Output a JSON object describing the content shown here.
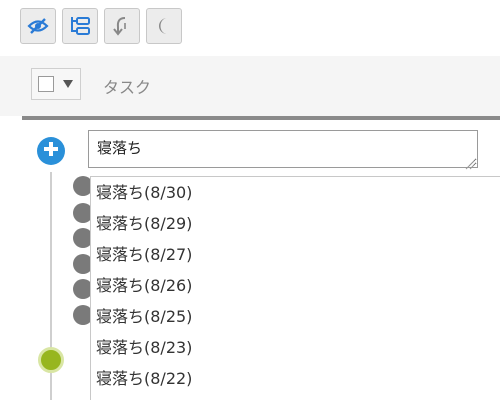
{
  "toolbar": {
    "buttons": [
      {
        "icon": "eye-slash-icon",
        "color": "#2a7bd6"
      },
      {
        "icon": "subtask-list-icon",
        "color": "#2a7bd6"
      },
      {
        "icon": "arrow-down-hook-icon",
        "color": "#888888"
      },
      {
        "icon": "moon-icon",
        "color": "#888888"
      }
    ]
  },
  "header": {
    "column_title": "タスク"
  },
  "task_input": {
    "value": "寝落ち"
  },
  "suggestions": [
    "寝落ち(8/30)",
    "寝落ち(8/29)",
    "寝落ち(8/27)",
    "寝落ち(8/26)",
    "寝落ち(8/25)",
    "寝落ち(8/23)",
    "寝落ち(8/22)"
  ],
  "colors": {
    "accent_blue": "#2a90d9",
    "status_green": "#97b61f",
    "status_gray": "#7a7a7a"
  }
}
